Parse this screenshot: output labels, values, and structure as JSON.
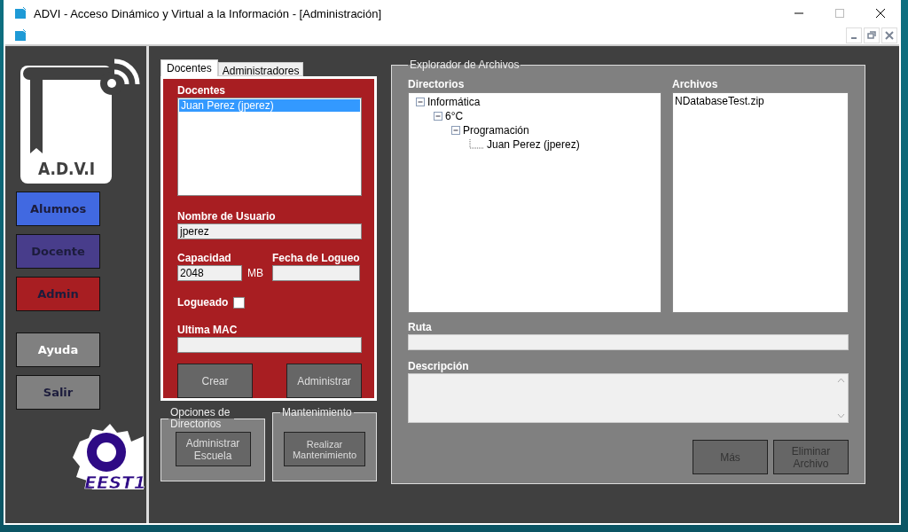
{
  "window": {
    "title": "ADVI - Acceso Dinámico y Virtual a la Información - [Administración]"
  },
  "sidebar": {
    "logo_text": "A.D.V.I",
    "school_logo_text": "EEST1",
    "buttons": [
      {
        "label": "Alumnos",
        "color": "#4169e1",
        "hovered": false
      },
      {
        "label": "Docente",
        "color": "#483d8b",
        "hovered": false
      },
      {
        "label": "Admin",
        "color": "#a81e22",
        "hovered": false
      },
      {
        "label": "Ayuda",
        "color": "#808080",
        "hovered": true
      },
      {
        "label": "Salir",
        "color": "#808080",
        "hovered": false
      }
    ]
  },
  "tabs": [
    {
      "label": "Docentes",
      "selected": true
    },
    {
      "label": "Administradores",
      "selected": false
    }
  ],
  "docentes": {
    "list_label": "Docentes",
    "list": [
      {
        "label": "Juan Perez (jperez)",
        "selected": true
      }
    ],
    "username_label": "Nombre de Usuario",
    "username": "jperez",
    "capacity_label": "Capacidad",
    "capacity": "2048",
    "capacity_unit": "MB",
    "login_date_label": "Fecha de Logueo",
    "logged_label": "Logueado",
    "logged": false,
    "mac_label": "Ultima MAC",
    "buttons": [
      "Crear",
      "Administrar"
    ]
  },
  "directory_options": {
    "title": "Opciones de Directorios",
    "button": "Administrar Escuela"
  },
  "maintenance": {
    "title": "Mantenimiento",
    "button": "Realizar Mantenimiento"
  },
  "explorer": {
    "title": "Explorador de Archivos",
    "directories_label": "Directorios",
    "tree": [
      {
        "label": "Informática",
        "children": [
          {
            "label": "6°C",
            "children": [
              {
                "label": "Programación",
                "children": [
                  {
                    "label": "Juan Perez (jperez)"
                  }
                ]
              }
            ]
          }
        ]
      }
    ],
    "files_label": "Archivos",
    "files": [
      "NDatabaseTest.zip"
    ],
    "path_label": "Ruta",
    "description_label": "Descripción",
    "buttons": [
      "Más",
      "Eliminar Archivo"
    ]
  }
}
